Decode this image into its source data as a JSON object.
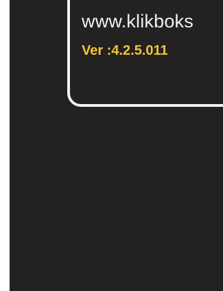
{
  "info_panel": {
    "site_url": "www.klikboks",
    "version": "Ver :4.2.5.011"
  },
  "colors": {
    "background": "#242220",
    "panel_border": "#f2f2f2",
    "url_text": "#f0f0f0",
    "version_text": "#f2c23a"
  }
}
